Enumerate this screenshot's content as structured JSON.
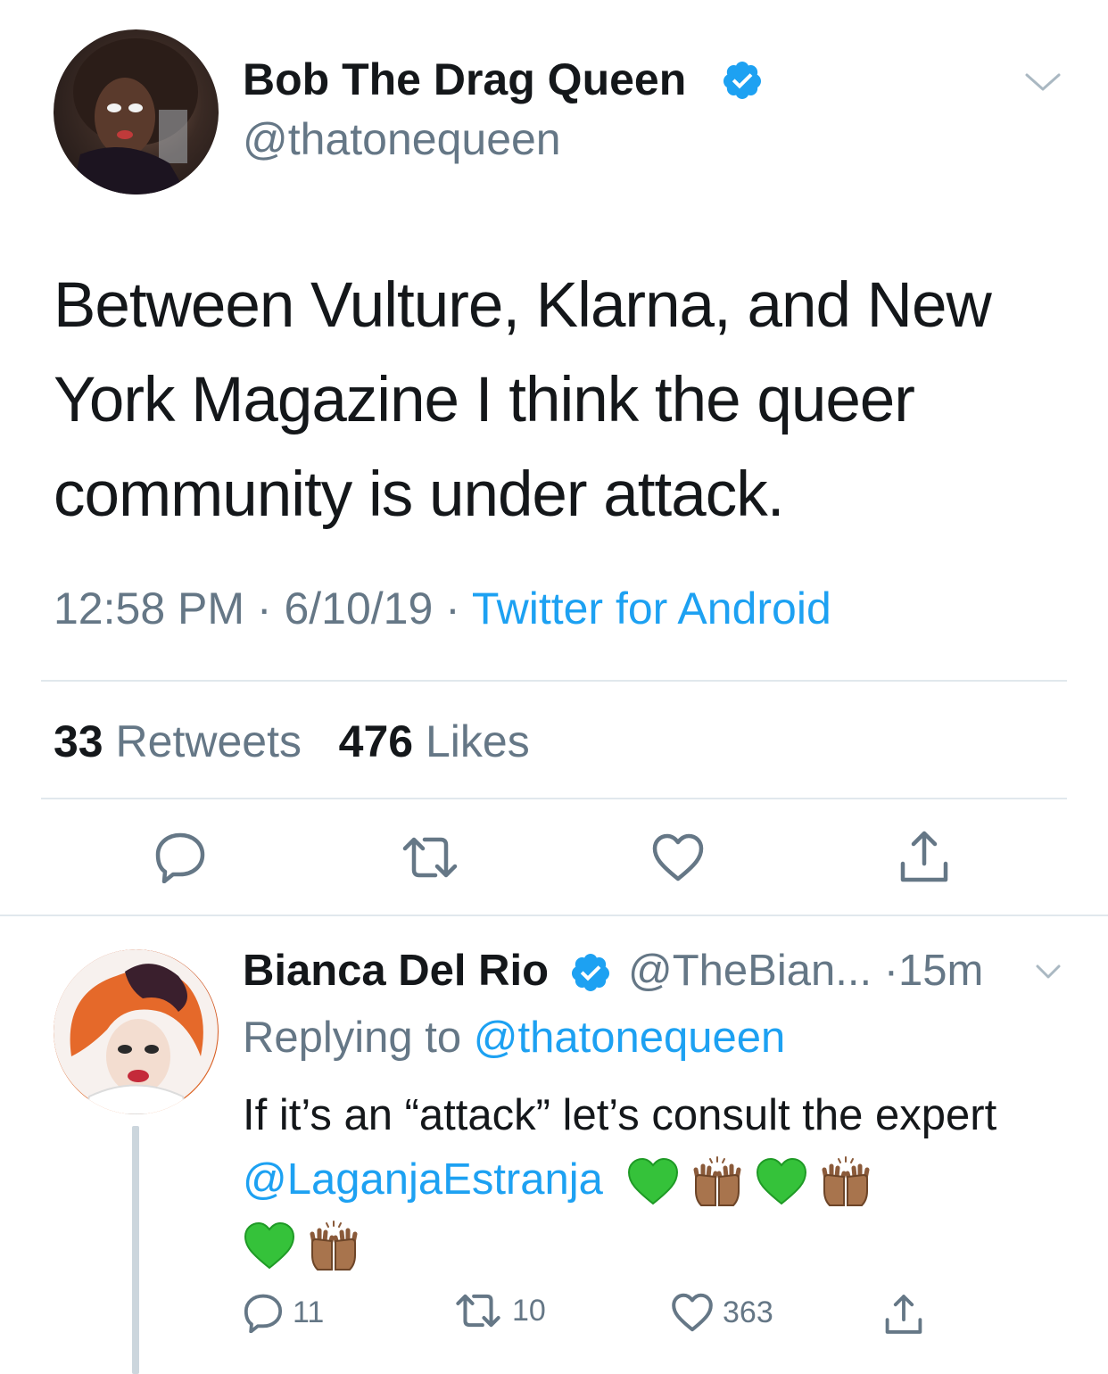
{
  "tweet": {
    "display_name": "Bob The Drag Queen",
    "handle": "@thatonequeen",
    "text": "Between Vulture, Klarna, and New York Magazine I think the queer community is under attack.",
    "time": "12:58 PM",
    "sep1": " · ",
    "date": "6/10/19",
    "sep2": " · ",
    "source": "Twitter for Android",
    "retweets_count": "33",
    "retweets_label": "Retweets",
    "likes_count": "476",
    "likes_label": "Likes"
  },
  "reply": {
    "display_name": "Bianca Del Rio",
    "handle_time": "@TheBian... ·15m",
    "replying_prefix": "Replying to ",
    "replying_to": "@thatonequeen",
    "text_before": "If it’s an “attack” let’s consult the expert ",
    "mention": "@LaganjaEstranja",
    "emojis": [
      "green-heart",
      "raising-hands",
      "green-heart",
      "raising-hands",
      "green-heart",
      "raising-hands"
    ],
    "reply_count": "11",
    "retweet_count": "10",
    "like_count": "363"
  },
  "colors": {
    "text": "#14171a",
    "secondary": "#657786",
    "accent": "#1da1f2",
    "divider": "#e1e8ed",
    "verified": "#1da1f2"
  }
}
